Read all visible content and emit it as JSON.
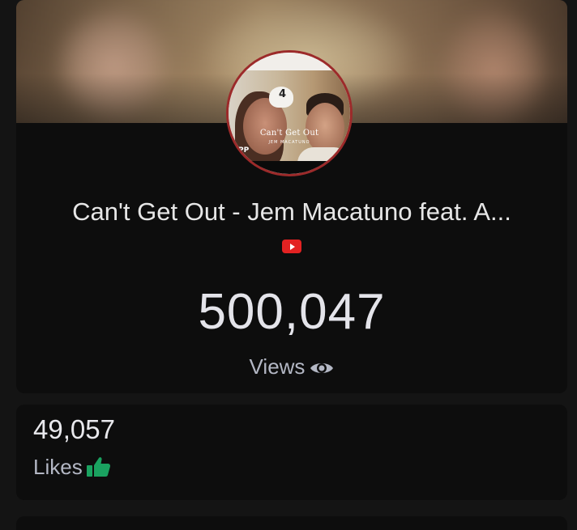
{
  "video": {
    "title": "Can't Get Out - Jem Macatuno feat. A...",
    "thumbnail_title": "Can't Get Out",
    "thumbnail_subtitle": "JEM MACATUNO",
    "thumbnail_corner": "PP",
    "thumbnail_cap_number": "4",
    "platform_icon": "youtube-icon"
  },
  "views": {
    "count": "500,047",
    "label": "Views",
    "icon": "eye-icon"
  },
  "likes": {
    "count": "49,057",
    "label": "Likes",
    "icon": "thumbs-up-icon"
  },
  "colors": {
    "background": "#141414",
    "card": "#0d0d0d",
    "youtube_red": "#e32222",
    "thumb_border": "#9c2a2a",
    "likes_green": "#1aa260",
    "label_gray": "#b3b7c4"
  }
}
